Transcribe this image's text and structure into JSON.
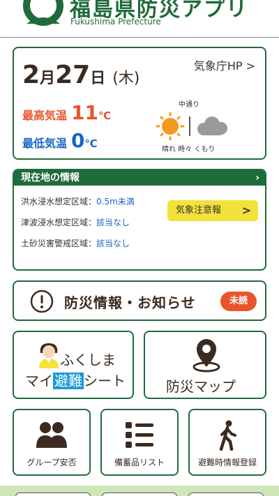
{
  "header": {
    "app_name": "福島県防災アプリ",
    "prefecture": "Fukushima Prefecture"
  },
  "weather": {
    "month": "2",
    "month_unit": "月",
    "day": "27",
    "day_unit": "日",
    "weekday": "(木)",
    "jma_link": "気象庁HP >",
    "high_label": "最高気温",
    "high_value": "11",
    "low_label": "最低気温",
    "low_value": "0",
    "temp_unit": "℃",
    "region": "中通り",
    "forecast": "晴れ 時々 くもり",
    "icons": [
      "sun-icon",
      "cloud-icon"
    ]
  },
  "location_info": {
    "title": "現在地の情報",
    "rows": [
      {
        "label": "洪水浸水想定区域：",
        "value": "0.5m未満"
      },
      {
        "label": "津波浸水想定区域：",
        "value": "該当なし"
      },
      {
        "label": "土砂災害警戒区域：",
        "value": "該当なし"
      }
    ],
    "warning_button": "気象注意報",
    "warning_arrow": ">"
  },
  "notice": {
    "label": "防災情報・お知らせ",
    "badge": "未読"
  },
  "my_sheet": {
    "line1": "ふくしま",
    "line2_pre": "マイ",
    "line2_hl": "避難",
    "line2_post": "シート"
  },
  "map_button": {
    "label": "防災マップ"
  },
  "small_buttons": [
    {
      "label": "グループ安否"
    },
    {
      "label": "備蓄品リスト"
    },
    {
      "label": "避難時情報登録"
    }
  ],
  "colors": {
    "brand_green": "#1f6b3a",
    "accent_orange": "#e8552b",
    "link_blue": "#1a64c8",
    "warning_yellow": "#f4e23c"
  }
}
